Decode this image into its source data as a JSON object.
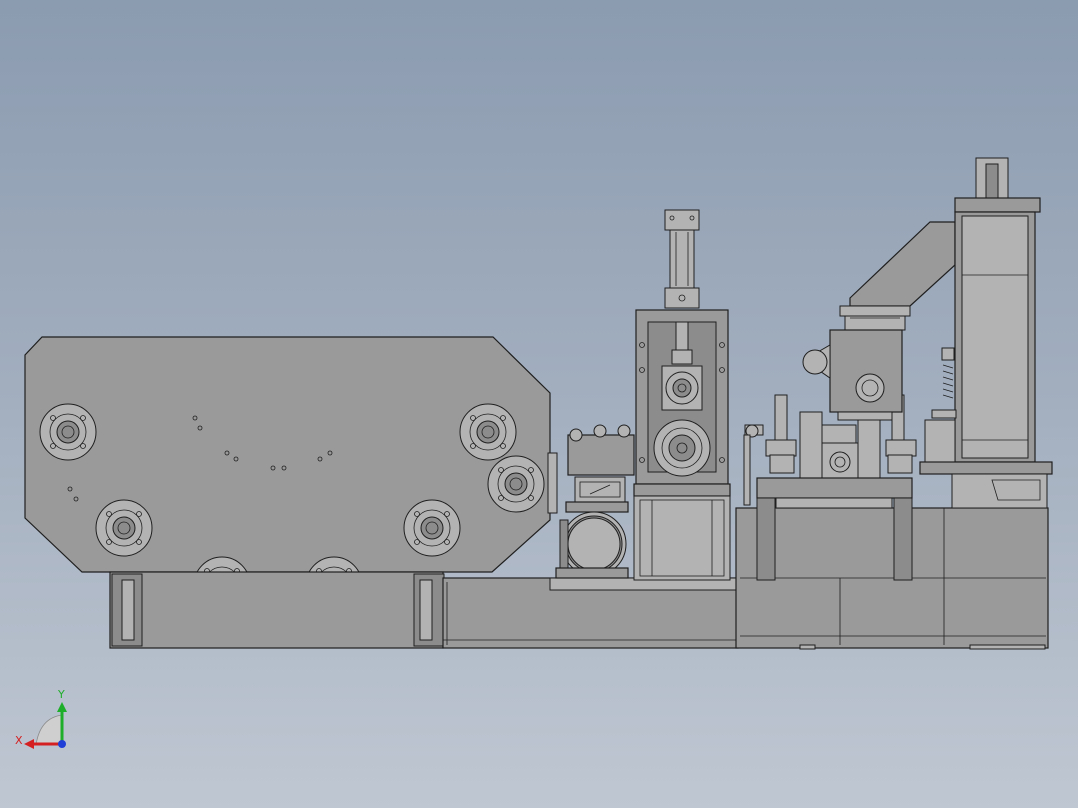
{
  "viewport": {
    "background_top": "#8b9bb0",
    "background_bottom": "#bfc7d2",
    "model_fill": "#9a9a9a",
    "edge_color": "#1f1f1f"
  },
  "triad": {
    "x_label": "X",
    "y_label": "Y",
    "x_color": "#d42020",
    "y_color": "#1fae2a",
    "z_color": "#1f3fd6"
  }
}
